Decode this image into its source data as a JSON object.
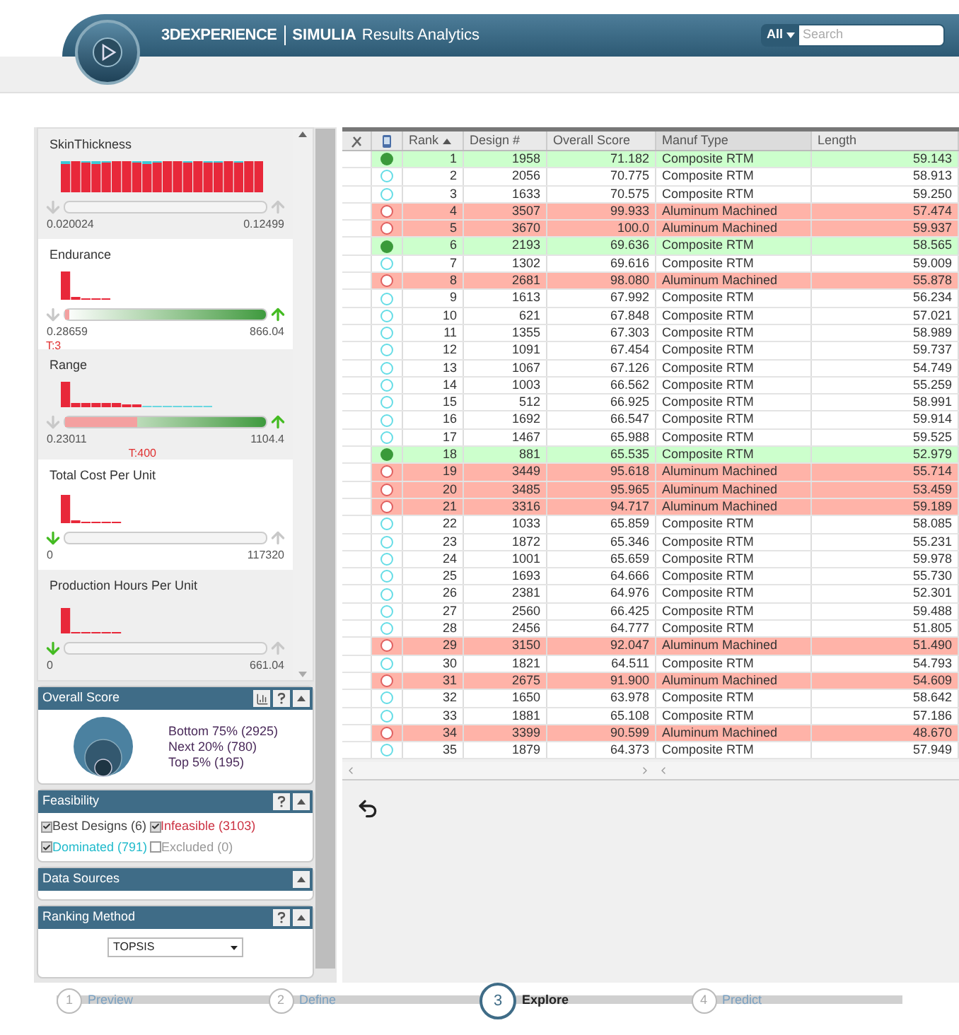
{
  "header": {
    "brand": "3DEXPERIENCE",
    "product": "SIMULIA",
    "app": "Results Analytics",
    "search_scope": "All",
    "search": {
      "placeholder": "Search"
    }
  },
  "filters": [
    {
      "name": "SkinThickness",
      "min": "0.020024",
      "max": "0.12499",
      "minimize": false,
      "maximize": false,
      "kind": "plain"
    },
    {
      "name": "Endurance",
      "min": "0.28659",
      "max": "866.04",
      "minimize": false,
      "maximize": true,
      "kind": "gradient",
      "target": "T:3",
      "level": 0.02
    },
    {
      "name": "Range",
      "min": "0.23011",
      "max": "1104.4",
      "minimize": false,
      "maximize": true,
      "kind": "gradient",
      "target": "T:400",
      "level": 0.36
    },
    {
      "name": "Total Cost Per Unit",
      "min": "0",
      "max": "117320",
      "minimize": true,
      "maximize": false,
      "kind": "plain"
    },
    {
      "name": "Production Hours Per Unit",
      "min": "0",
      "max": "661.04",
      "minimize": true,
      "maximize": false,
      "kind": "plain"
    }
  ],
  "overall_score": {
    "title": "Overall Score",
    "legend": [
      "Bottom 75% (2925)",
      "Next 20% (780)",
      "Top 5% (195)"
    ]
  },
  "feasibility": {
    "title": "Feasibility",
    "items": [
      {
        "label": "Best Designs (6)",
        "checked": true,
        "color": "#444444"
      },
      {
        "label": "Infeasible (3103)",
        "checked": true,
        "color": "#cc3344"
      },
      {
        "label": "Dominated (791)",
        "checked": true,
        "color": "#22bbcc"
      },
      {
        "label": "Excluded (0)",
        "checked": false,
        "color": "#999999"
      }
    ]
  },
  "data_sources": {
    "title": "Data Sources"
  },
  "ranking_method": {
    "title": "Ranking Method",
    "value": "TOPSIS"
  },
  "table": {
    "columns": [
      "Rank",
      "Design #",
      "Overall Score",
      "Manuf Type",
      "Length"
    ],
    "rows": [
      {
        "kind": "best",
        "cells": [
          "1",
          "1958",
          "71.182",
          "Composite RTM",
          "59.143"
        ]
      },
      {
        "kind": "dominated",
        "cells": [
          "2",
          "2056",
          "70.775",
          "Composite RTM",
          "58.913"
        ]
      },
      {
        "kind": "dominated",
        "cells": [
          "3",
          "1633",
          "70.575",
          "Composite RTM",
          "59.250"
        ]
      },
      {
        "kind": "infeasible",
        "cells": [
          "4",
          "3507",
          "99.933",
          "Aluminum Machined",
          "57.474"
        ]
      },
      {
        "kind": "infeasible",
        "cells": [
          "5",
          "3670",
          "100.0",
          "Aluminum Machined",
          "59.937"
        ]
      },
      {
        "kind": "best",
        "cells": [
          "6",
          "2193",
          "69.636",
          "Composite RTM",
          "58.565"
        ]
      },
      {
        "kind": "dominated",
        "cells": [
          "7",
          "1302",
          "69.616",
          "Composite RTM",
          "59.009"
        ]
      },
      {
        "kind": "infeasible",
        "cells": [
          "8",
          "2681",
          "98.080",
          "Aluminum Machined",
          "55.878"
        ]
      },
      {
        "kind": "dominated",
        "cells": [
          "9",
          "1613",
          "67.992",
          "Composite RTM",
          "56.234"
        ]
      },
      {
        "kind": "dominated",
        "cells": [
          "10",
          "621",
          "67.848",
          "Composite RTM",
          "57.021"
        ]
      },
      {
        "kind": "dominated",
        "cells": [
          "11",
          "1355",
          "67.303",
          "Composite RTM",
          "58.989"
        ]
      },
      {
        "kind": "dominated",
        "cells": [
          "12",
          "1091",
          "67.454",
          "Composite RTM",
          "59.737"
        ]
      },
      {
        "kind": "dominated",
        "cells": [
          "13",
          "1067",
          "67.126",
          "Composite RTM",
          "54.749"
        ]
      },
      {
        "kind": "dominated",
        "cells": [
          "14",
          "1003",
          "66.562",
          "Composite RTM",
          "55.259"
        ]
      },
      {
        "kind": "dominated",
        "cells": [
          "15",
          "512",
          "66.925",
          "Composite RTM",
          "58.991"
        ]
      },
      {
        "kind": "dominated",
        "cells": [
          "16",
          "1692",
          "66.547",
          "Composite RTM",
          "59.914"
        ]
      },
      {
        "kind": "dominated",
        "cells": [
          "17",
          "1467",
          "65.988",
          "Composite RTM",
          "59.525"
        ]
      },
      {
        "kind": "best",
        "cells": [
          "18",
          "881",
          "65.535",
          "Composite RTM",
          "52.979"
        ]
      },
      {
        "kind": "infeasible",
        "cells": [
          "19",
          "3449",
          "95.618",
          "Aluminum Machined",
          "55.714"
        ]
      },
      {
        "kind": "infeasible",
        "cells": [
          "20",
          "3485",
          "95.965",
          "Aluminum Machined",
          "53.459"
        ]
      },
      {
        "kind": "infeasible",
        "cells": [
          "21",
          "3316",
          "94.717",
          "Aluminum Machined",
          "59.189"
        ]
      },
      {
        "kind": "dominated",
        "cells": [
          "22",
          "1033",
          "65.859",
          "Composite RTM",
          "58.085"
        ]
      },
      {
        "kind": "dominated",
        "cells": [
          "23",
          "1872",
          "65.346",
          "Composite RTM",
          "55.231"
        ]
      },
      {
        "kind": "dominated",
        "cells": [
          "24",
          "1001",
          "65.659",
          "Composite RTM",
          "59.978"
        ]
      },
      {
        "kind": "dominated",
        "cells": [
          "25",
          "1693",
          "64.666",
          "Composite RTM",
          "55.730"
        ]
      },
      {
        "kind": "dominated",
        "cells": [
          "26",
          "2381",
          "64.976",
          "Composite RTM",
          "52.301"
        ]
      },
      {
        "kind": "dominated",
        "cells": [
          "27",
          "2560",
          "66.425",
          "Composite RTM",
          "59.488"
        ]
      },
      {
        "kind": "dominated",
        "cells": [
          "28",
          "2456",
          "64.777",
          "Composite RTM",
          "51.805"
        ]
      },
      {
        "kind": "infeasible",
        "cells": [
          "29",
          "3150",
          "92.047",
          "Aluminum Machined",
          "51.490"
        ]
      },
      {
        "kind": "dominated",
        "cells": [
          "30",
          "1821",
          "64.511",
          "Composite RTM",
          "54.793"
        ]
      },
      {
        "kind": "infeasible",
        "cells": [
          "31",
          "2675",
          "91.900",
          "Aluminum Machined",
          "54.609"
        ]
      },
      {
        "kind": "dominated",
        "cells": [
          "32",
          "1650",
          "63.978",
          "Composite RTM",
          "58.642"
        ]
      },
      {
        "kind": "dominated",
        "cells": [
          "33",
          "1881",
          "65.108",
          "Composite RTM",
          "57.186"
        ]
      },
      {
        "kind": "infeasible",
        "cells": [
          "34",
          "3399",
          "90.599",
          "Aluminum Machined",
          "48.670"
        ]
      },
      {
        "kind": "dominated",
        "cells": [
          "35",
          "1879",
          "64.373",
          "Composite RTM",
          "57.949"
        ]
      }
    ]
  },
  "wizard": [
    {
      "number": "1",
      "label": "Preview",
      "selected": false
    },
    {
      "number": "2",
      "label": "Define",
      "selected": false
    },
    {
      "number": "3",
      "label": "Explore",
      "selected": true
    },
    {
      "number": "4",
      "label": "Predict",
      "selected": false
    }
  ]
}
